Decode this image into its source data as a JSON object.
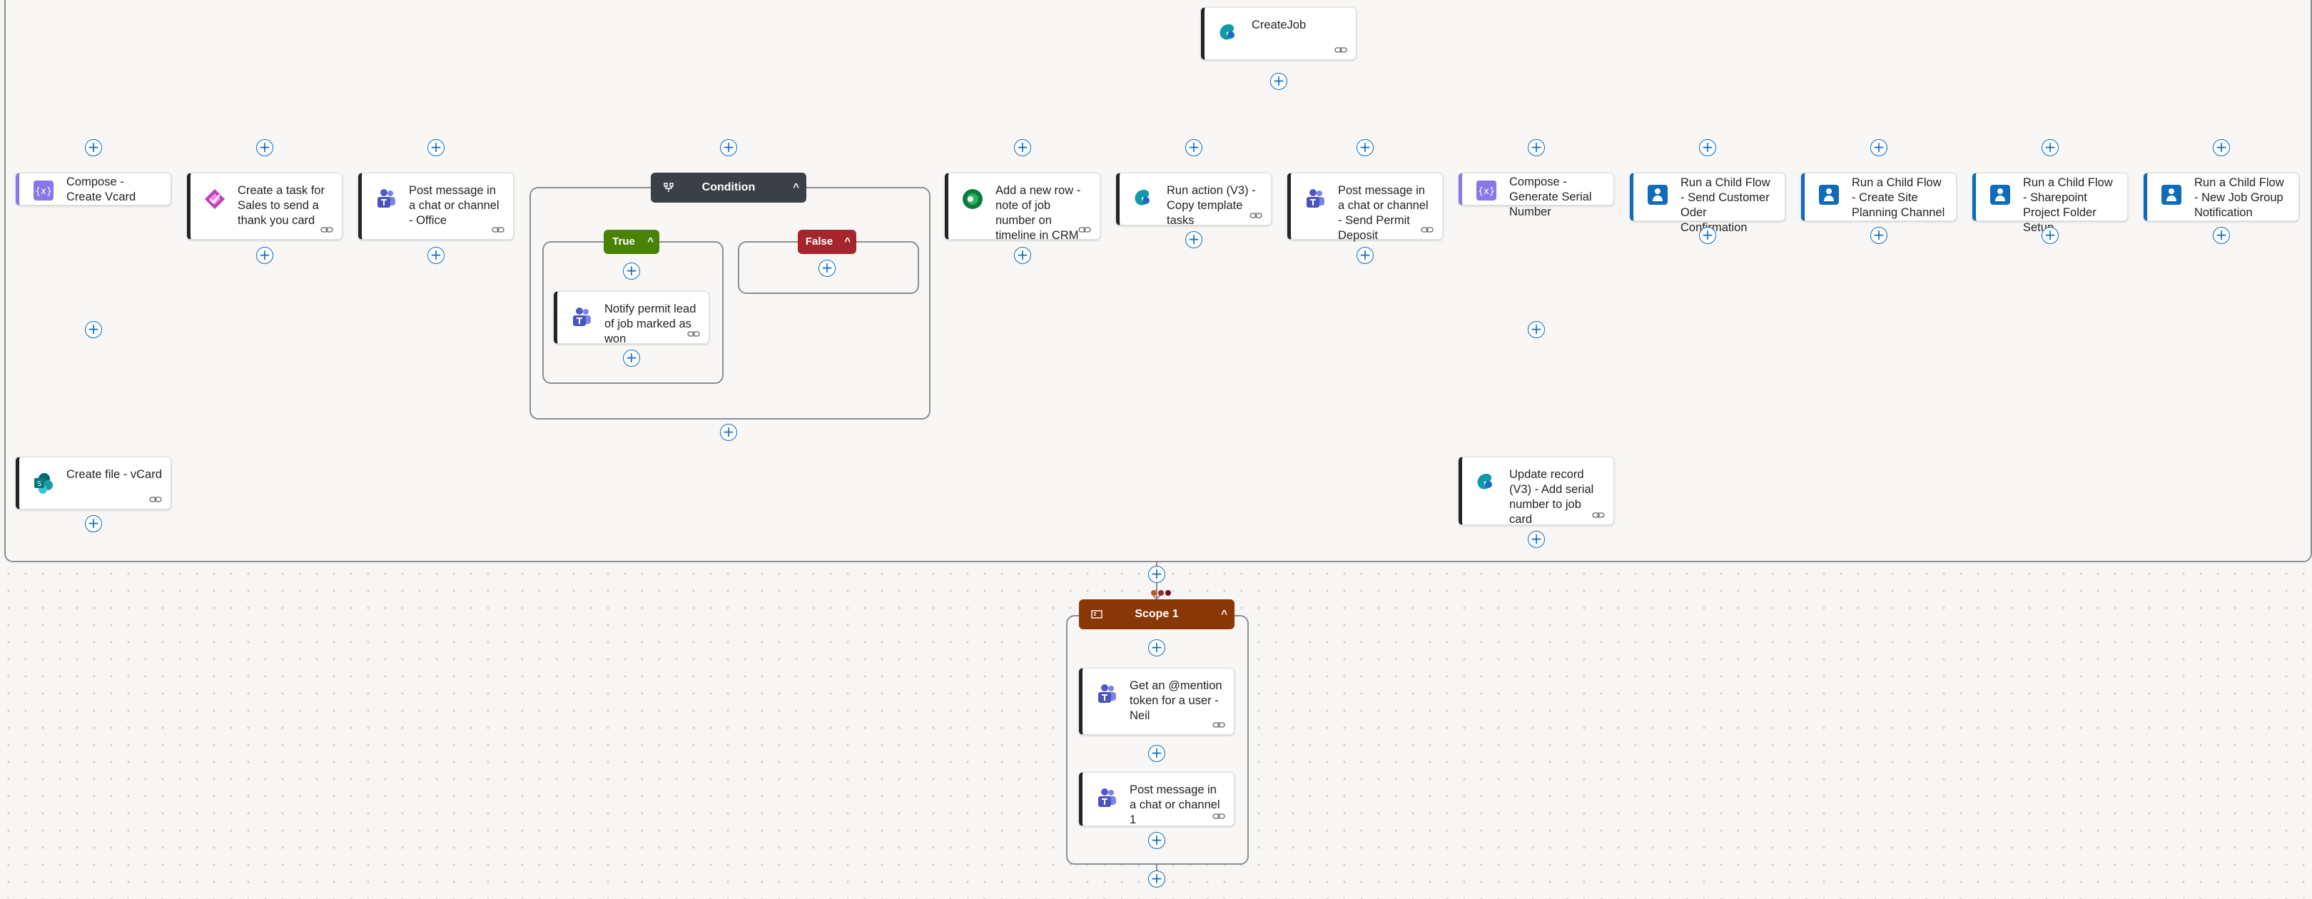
{
  "flow": {
    "top_action": {
      "label": "CreateJob",
      "icon": "dataverse-icon"
    },
    "branches": [
      {
        "label": "Compose - Create Vcard",
        "icon": "compose-icon",
        "accent": "#8a76e8"
      },
      {
        "label": "Create a task for Sales to send a thank you card",
        "icon": "planner-icon",
        "accent": "#242424"
      },
      {
        "label": "Post message in a chat or channel - Office",
        "icon": "teams-icon",
        "accent": "#242424"
      },
      {
        "label": "Add a new row - note of job number on timeline in CRM",
        "icon": "dynamics-icon",
        "accent": "#242424"
      },
      {
        "label": "Run action (V3) - Copy template tasks",
        "icon": "dataverse-icon",
        "accent": "#242424"
      },
      {
        "label": "Post message in a chat or channel - Send Permit Deposit",
        "icon": "teams-icon",
        "accent": "#242424"
      },
      {
        "label": "Compose - Generate Serial Number",
        "icon": "compose-icon",
        "accent": "#8a76e8"
      },
      {
        "label": "Run a Child Flow - Send Customer Oder Confirmation",
        "icon": "child-flow-icon",
        "accent": "#0f6cbd"
      },
      {
        "label": "Run a Child Flow - Create Site Planning Channel",
        "icon": "child-flow-icon",
        "accent": "#0f6cbd"
      },
      {
        "label": "Run a Child Flow - Sharepoint Project Folder Setup",
        "icon": "child-flow-icon",
        "accent": "#0f6cbd"
      },
      {
        "label": "Run a Child Flow - New Job Group Notification",
        "icon": "child-flow-icon",
        "accent": "#0f6cbd"
      }
    ],
    "condition": {
      "label": "Condition",
      "true_label": "True",
      "false_label": "False",
      "true_action": {
        "label": "Notify permit lead of job marked as won",
        "icon": "teams-icon"
      }
    },
    "create_file": {
      "label": "Create file - vCard",
      "icon": "sharepoint-icon"
    },
    "update_record": {
      "label": "Update record (V3) - Add serial number to job card",
      "icon": "dataverse-icon"
    },
    "scope": {
      "label": "Scope 1",
      "actions": [
        {
          "label": "Get an @mention token for a user - Neil",
          "icon": "teams-icon"
        },
        {
          "label": "Post message in a chat or channel 1",
          "icon": "teams-icon"
        }
      ]
    },
    "plus_symbol": "+",
    "chevron_symbol": "^",
    "colors": {
      "connector_line": "#8e8e8e",
      "plus_blue": "#0f6cbd",
      "condition_header": "#3b3f46",
      "true_green": "#498205",
      "false_red": "#a4262c",
      "scope_header": "#8a3707",
      "compose_purple": "#8a76e8",
      "child_flow_blue": "#0f6cbd"
    }
  }
}
